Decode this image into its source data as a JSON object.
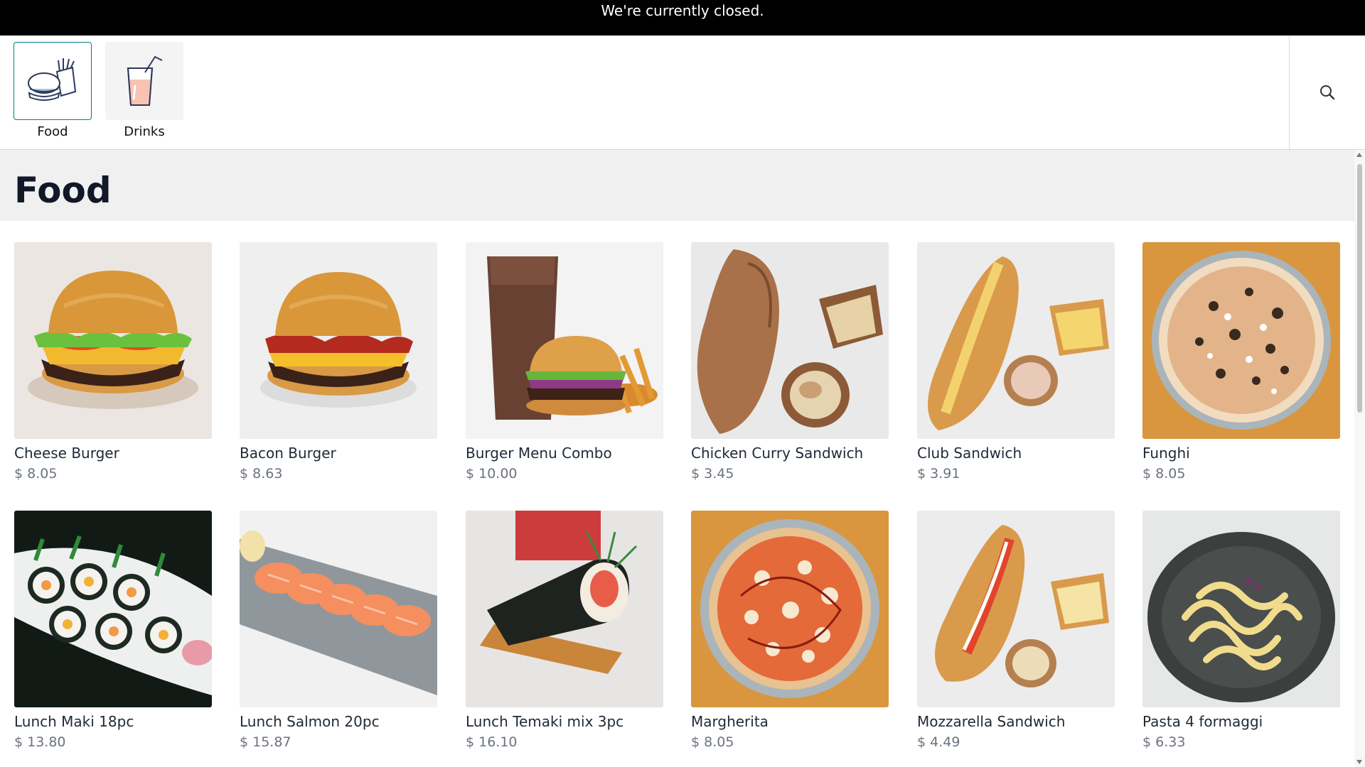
{
  "banner": {
    "text": "We're currently closed."
  },
  "categories": [
    {
      "label": "Food",
      "icon": "burger-fries-icon",
      "active": true
    },
    {
      "label": "Drinks",
      "icon": "drink-glass-icon",
      "active": false
    }
  ],
  "search": {
    "icon": "search-icon"
  },
  "section": {
    "title": "Food"
  },
  "products": [
    {
      "name": "Cheese Burger",
      "price": "$ 8.05",
      "image": "cheese-burger-image"
    },
    {
      "name": "Bacon Burger",
      "price": "$ 8.63",
      "image": "bacon-burger-image"
    },
    {
      "name": "Burger Menu Combo",
      "price": "$ 10.00",
      "image": "burger-combo-image"
    },
    {
      "name": "Chicken Curry Sandwich",
      "price": "$ 3.45",
      "image": "chicken-curry-sandwich-image"
    },
    {
      "name": "Club Sandwich",
      "price": "$ 3.91",
      "image": "club-sandwich-image"
    },
    {
      "name": "Funghi",
      "price": "$ 8.05",
      "image": "funghi-pizza-image"
    },
    {
      "name": "Lunch Maki 18pc",
      "price": "$ 13.80",
      "image": "maki-image"
    },
    {
      "name": "Lunch Salmon 20pc",
      "price": "$ 15.87",
      "image": "salmon-sushi-image"
    },
    {
      "name": "Lunch Temaki mix 3pc",
      "price": "$ 16.10",
      "image": "temaki-image"
    },
    {
      "name": "Margherita",
      "price": "$ 8.05",
      "image": "margherita-pizza-image"
    },
    {
      "name": "Mozzarella Sandwich",
      "price": "$ 4.49",
      "image": "mozzarella-sandwich-image"
    },
    {
      "name": "Pasta 4 formaggi",
      "price": "$ 6.33",
      "image": "pasta-image"
    }
  ],
  "colors": {
    "banner_bg": "#000000",
    "accent": "#017e84",
    "muted_text": "#6b7280"
  }
}
